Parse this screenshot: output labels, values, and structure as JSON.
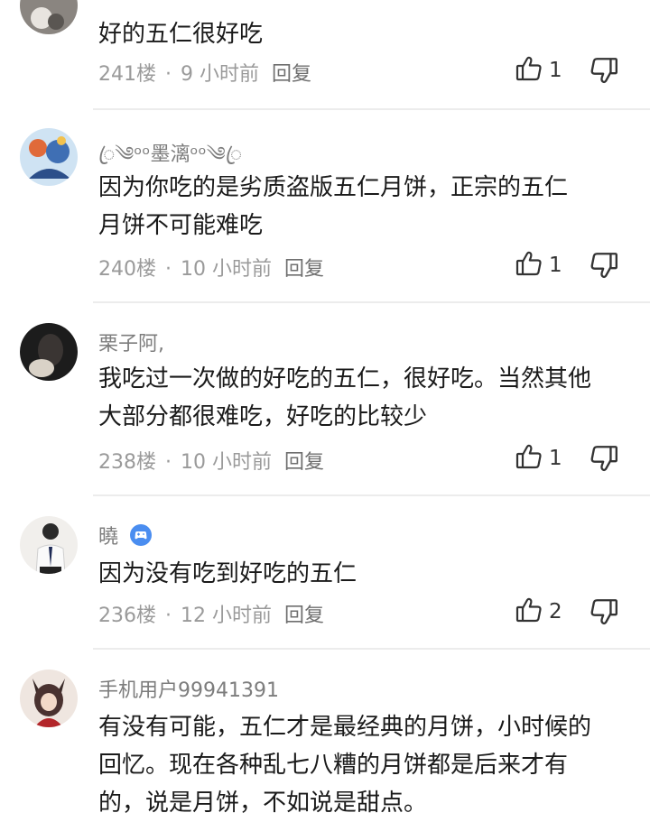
{
  "comments": [
    {
      "username": "",
      "text_lines": [
        "好的五仁很好吃"
      ],
      "floor": "241楼",
      "time": "9 小时前",
      "reply_label": "回复",
      "likes": "1"
    },
    {
      "username": "ꦿ༄ᵒᵒ墨漓ᵒᵒ༄ꦿ",
      "text_lines": [
        "因为你吃的是劣质盗版五仁月饼，正宗的五仁",
        "月饼不可能难吃"
      ],
      "floor": "240楼",
      "time": "10 小时前",
      "reply_label": "回复",
      "likes": "1"
    },
    {
      "username": "栗子阿,",
      "text_lines": [
        "我吃过一次做的好吃的五仁，很好吃。当然其他",
        "大部分都很难吃，好吃的比较少"
      ],
      "floor": "238楼",
      "time": "10 小时前",
      "reply_label": "回复",
      "likes": "1"
    },
    {
      "username": "曉",
      "text_lines": [
        "因为没有吃到好吃的五仁"
      ],
      "floor": "236楼",
      "time": "12 小时前",
      "reply_label": "回复",
      "likes": "2"
    },
    {
      "username": "手机用户99941391",
      "text_lines": [
        "有没有可能，五仁才是最经典的月饼，小时候的",
        "回忆。现在各种乱七八糟的月饼都是后来才有",
        "的，说是月饼，不如说是甜点。"
      ],
      "floor": "",
      "time": "",
      "reply_label": "",
      "likes": ""
    }
  ],
  "meta_separator": "·",
  "icons": {
    "like": "thumbs-up-icon",
    "dislike": "thumbs-down-icon",
    "badge": "game-controller-badge-icon"
  },
  "colors": {
    "meta": "#9a9a9a",
    "username": "#7d7d7d",
    "text": "#1a1a1a",
    "badge": "#4a8df0"
  }
}
